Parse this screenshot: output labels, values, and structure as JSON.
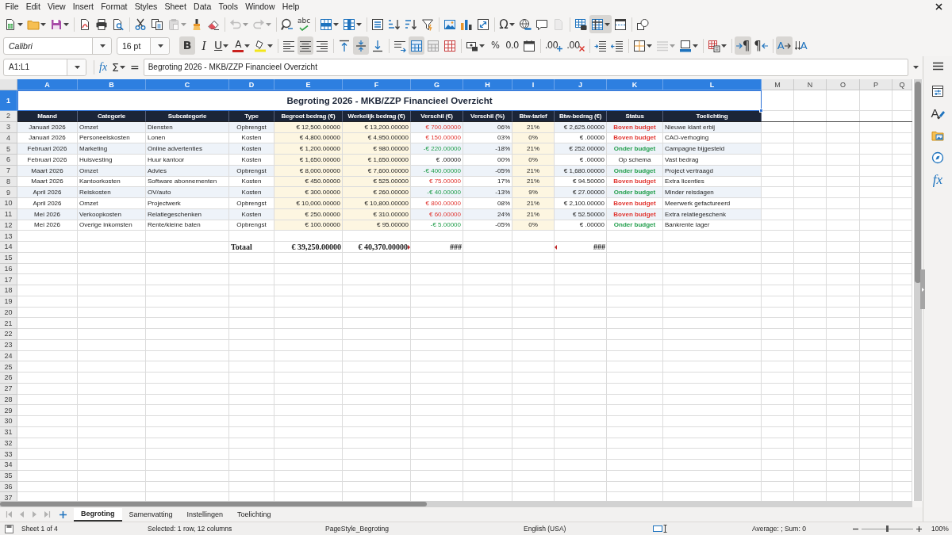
{
  "menu_bar": {
    "items": [
      "File",
      "Edit",
      "View",
      "Insert",
      "Format",
      "Styles",
      "Sheet",
      "Data",
      "Tools",
      "Window",
      "Help"
    ]
  },
  "standard_toolbar": [
    [
      {
        "pressed": false,
        "disabled": false,
        "dropdown": true
      },
      {
        "pressed": false,
        "disabled": false,
        "dropdown": true
      },
      {
        "pressed": false,
        "disabled": false,
        "dropdown": true
      }
    ],
    [
      {
        "pressed": false,
        "disabled": false,
        "dropdown": false
      },
      {
        "pressed": false,
        "disabled": false,
        "dropdown": false
      },
      {
        "pressed": false,
        "disabled": false,
        "dropdown": false
      }
    ],
    [
      {
        "pressed": false,
        "disabled": false,
        "dropdown": false
      },
      {
        "pressed": false,
        "disabled": false,
        "dropdown": false
      },
      {
        "pressed": false,
        "disabled": true,
        "dropdown": true
      },
      {
        "pressed": false,
        "disabled": false,
        "dropdown": false
      },
      {
        "pressed": false,
        "disabled": false,
        "dropdown": false
      }
    ],
    [
      {
        "pressed": false,
        "disabled": true,
        "dropdown": true
      },
      {
        "pressed": false,
        "disabled": true,
        "dropdown": true
      }
    ],
    [
      {
        "pressed": false,
        "disabled": false,
        "dropdown": false
      },
      {
        "pressed": false,
        "disabled": false,
        "dropdown": false,
        "glyph": "abc"
      }
    ],
    [
      {
        "pressed": false,
        "disabled": false,
        "dropdown": true
      },
      {
        "pressed": false,
        "disabled": false,
        "dropdown": true
      }
    ],
    [
      {
        "pressed": false,
        "disabled": false,
        "dropdown": false
      },
      {
        "pressed": false,
        "disabled": false,
        "dropdown": false
      },
      {
        "pressed": false,
        "disabled": false,
        "dropdown": false
      },
      {
        "pressed": false,
        "disabled": false,
        "dropdown": false
      }
    ],
    [
      {
        "pressed": false,
        "disabled": false,
        "dropdown": false
      },
      {
        "pressed": false,
        "disabled": false,
        "dropdown": false
      },
      {
        "pressed": false,
        "disabled": false,
        "dropdown": false
      }
    ],
    [
      {
        "pressed": false,
        "disabled": false,
        "dropdown": true,
        "glyph": "Ω"
      },
      {
        "pressed": false,
        "disabled": false,
        "dropdown": false
      },
      {
        "pressed": false,
        "disabled": false,
        "dropdown": false
      },
      {
        "pressed": false,
        "disabled": true,
        "dropdown": false
      }
    ],
    [
      {
        "pressed": false,
        "disabled": false,
        "dropdown": false
      },
      {
        "pressed": true,
        "disabled": false,
        "dropdown": true
      },
      {
        "pressed": false,
        "disabled": false,
        "dropdown": false
      }
    ],
    [
      {
        "pressed": false,
        "disabled": false,
        "dropdown": false
      }
    ]
  ],
  "formatting_toolbar": {
    "font_name": "Calibri",
    "font_size": "16 pt",
    "groups": [
      [
        {
          "pressed": true,
          "disabled": false,
          "dropdown": false,
          "glyph": "B"
        },
        {
          "pressed": false,
          "disabled": false,
          "dropdown": false,
          "glyph": "I"
        },
        {
          "pressed": false,
          "disabled": false,
          "dropdown": true,
          "glyph": "U"
        },
        {
          "pressed": false,
          "disabled": false,
          "dropdown": true,
          "glyph": "A"
        },
        {
          "pressed": false,
          "disabled": false,
          "dropdown": true
        }
      ],
      [
        {
          "pressed": false,
          "disabled": false,
          "dropdown": false
        },
        {
          "pressed": true,
          "disabled": false,
          "dropdown": false
        },
        {
          "pressed": false,
          "disabled": false,
          "dropdown": false
        }
      ],
      [
        {
          "pressed": false,
          "disabled": false,
          "dropdown": false
        },
        {
          "pressed": true,
          "disabled": false,
          "dropdown": false
        },
        {
          "pressed": false,
          "disabled": false,
          "dropdown": false
        }
      ],
      [
        {
          "pressed": false,
          "disabled": false,
          "dropdown": false
        },
        {
          "pressed": true,
          "disabled": false,
          "dropdown": false
        },
        {
          "pressed": false,
          "disabled": false,
          "dropdown": false
        },
        {
          "pressed": false,
          "disabled": false,
          "dropdown": false
        }
      ],
      [
        {
          "pressed": false,
          "disabled": false,
          "dropdown": true
        },
        {
          "pressed": false,
          "disabled": false,
          "dropdown": false,
          "glyph": "%"
        },
        {
          "pressed": false,
          "disabled": false,
          "dropdown": false,
          "glyph": "0.0"
        },
        {
          "pressed": false,
          "disabled": false,
          "dropdown": false
        }
      ],
      [
        {
          "pressed": false,
          "disabled": false,
          "dropdown": false,
          "glyph": ".00"
        },
        {
          "pressed": false,
          "disabled": false,
          "dropdown": false,
          "glyph": ".00"
        }
      ],
      [
        {
          "pressed": false,
          "disabled": false,
          "dropdown": false
        },
        {
          "pressed": false,
          "disabled": false,
          "dropdown": false
        }
      ],
      [
        {
          "pressed": false,
          "disabled": false,
          "dropdown": true
        },
        {
          "pressed": false,
          "disabled": true,
          "dropdown": true
        },
        {
          "pressed": false,
          "disabled": false,
          "dropdown": true
        }
      ],
      [
        {
          "pressed": false,
          "disabled": false,
          "dropdown": true
        }
      ],
      [
        {
          "pressed": true,
          "disabled": false,
          "dropdown": false,
          "glyph": "¶"
        },
        {
          "pressed": false,
          "disabled": false,
          "dropdown": false,
          "glyph": "¶"
        }
      ],
      [
        {
          "pressed": true,
          "disabled": false,
          "dropdown": false,
          "glyph": "A"
        },
        {
          "pressed": false,
          "disabled": false,
          "dropdown": false,
          "glyph": "A"
        }
      ]
    ]
  },
  "formula_bar": {
    "name_box": "A1:L1",
    "wizard_glyph": "fx",
    "sum_glyph": "Σ",
    "equals_glyph": "=",
    "content": "Begroting 2026 - MKB/ZZP Financieel Overzicht"
  },
  "sheet": {
    "columns": [
      {
        "label": "A",
        "selected": true
      },
      {
        "label": "B",
        "selected": true
      },
      {
        "label": "C",
        "selected": true
      },
      {
        "label": "D",
        "selected": true
      },
      {
        "label": "E",
        "selected": true
      },
      {
        "label": "F",
        "selected": true
      },
      {
        "label": "G",
        "selected": true
      },
      {
        "label": "H",
        "selected": true
      },
      {
        "label": "I",
        "selected": true
      },
      {
        "label": "J",
        "selected": true
      },
      {
        "label": "K",
        "selected": true
      },
      {
        "label": "L",
        "selected": true
      },
      {
        "label": "M",
        "selected": false
      },
      {
        "label": "N",
        "selected": false
      },
      {
        "label": "O",
        "selected": false
      },
      {
        "label": "P",
        "selected": false
      },
      {
        "label": "Q",
        "selected": false
      }
    ],
    "rows": [
      {
        "label": "1",
        "selected": true
      },
      {
        "label": "2",
        "selected": false
      },
      {
        "label": "3",
        "selected": false
      },
      {
        "label": "4",
        "selected": false
      },
      {
        "label": "5",
        "selected": false
      },
      {
        "label": "6",
        "selected": false
      },
      {
        "label": "7",
        "selected": false
      },
      {
        "label": "8",
        "selected": false
      },
      {
        "label": "9",
        "selected": false
      },
      {
        "label": "10",
        "selected": false
      },
      {
        "label": "11",
        "selected": false
      },
      {
        "label": "12",
        "selected": false
      },
      {
        "label": "13",
        "selected": false
      },
      {
        "label": "14",
        "selected": false
      },
      {
        "label": "15",
        "selected": false
      },
      {
        "label": "16",
        "selected": false
      },
      {
        "label": "17",
        "selected": false
      },
      {
        "label": "18",
        "selected": false
      },
      {
        "label": "19",
        "selected": false
      },
      {
        "label": "20",
        "selected": false
      },
      {
        "label": "21",
        "selected": false
      },
      {
        "label": "22",
        "selected": false
      },
      {
        "label": "23",
        "selected": false
      },
      {
        "label": "24",
        "selected": false
      },
      {
        "label": "25",
        "selected": false
      },
      {
        "label": "26",
        "selected": false
      },
      {
        "label": "27",
        "selected": false
      },
      {
        "label": "28",
        "selected": false
      },
      {
        "label": "29",
        "selected": false
      },
      {
        "label": "30",
        "selected": false
      },
      {
        "label": "31",
        "selected": false
      },
      {
        "label": "32",
        "selected": false
      },
      {
        "label": "33",
        "selected": false
      },
      {
        "label": "34",
        "selected": false
      },
      {
        "label": "35",
        "selected": false
      },
      {
        "label": "36",
        "selected": false
      },
      {
        "label": "37",
        "selected": false
      }
    ],
    "title": "Begroting 2026 - MKB/ZZP Financieel Overzicht",
    "header": [
      "Maand",
      "Categorie",
      "Subcategorie",
      "Type",
      "Begroot bedrag (€)",
      "Werkelijk bedrag (€)",
      "Verschil (€)",
      "Verschil (%)",
      "Btw-tarief",
      "Btw-bedrag (€)",
      "Status",
      "Toelichting"
    ],
    "data": [
      {
        "month": "Januari 2026",
        "category": "Omzet",
        "subcategory": "Diensten",
        "type": "Opbrengst",
        "budget": "€ 12,500.00000",
        "actual": "€ 13,200.00000",
        "difference": "€ 700.00000",
        "difference_pct": "06%",
        "vat_rate": "21%",
        "vat_amount": "€ 2,625.00000",
        "status": {
          "text": "Boven budget",
          "kind": "over"
        },
        "note": "Nieuwe klant erbij"
      },
      {
        "month": "Januari 2026",
        "category": "Personeelskosten",
        "subcategory": "Lonen",
        "type": "Kosten",
        "budget": "€ 4,800.00000",
        "actual": "€ 4,950.00000",
        "difference": "€ 150.00000",
        "difference_pct": "03%",
        "vat_rate": "0%",
        "vat_amount": "€ .00000",
        "status": {
          "text": "Boven budget",
          "kind": "over"
        },
        "note": "CAO-verhoging"
      },
      {
        "month": "Februari 2026",
        "category": "Marketing",
        "subcategory": "Online advertenties",
        "type": "Kosten",
        "budget": "€ 1,200.00000",
        "actual": "€ 980.00000",
        "difference": "-€ 220.00000",
        "difference_pct": "-18%",
        "vat_rate": "21%",
        "vat_amount": "€ 252.00000",
        "status": {
          "text": "Onder budget",
          "kind": "under"
        },
        "note": "Campagne bijgesteld"
      },
      {
        "month": "Februari 2026",
        "category": "Huisvesting",
        "subcategory": "Huur kantoor",
        "type": "Kosten",
        "budget": "€ 1,650.00000",
        "actual": "€ 1,650.00000",
        "difference": "€ .00000",
        "difference_pct": "00%",
        "vat_rate": "0%",
        "vat_amount": "€ .00000",
        "status": {
          "text": "Op schema",
          "kind": "on"
        },
        "note": "Vast bedrag"
      },
      {
        "month": "Maart 2026",
        "category": "Omzet",
        "subcategory": "Advies",
        "type": "Opbrengst",
        "budget": "€ 8,000.00000",
        "actual": "€ 7,600.00000",
        "difference": "-€ 400.00000",
        "difference_pct": "-05%",
        "vat_rate": "21%",
        "vat_amount": "€ 1,680.00000",
        "status": {
          "text": "Onder budget",
          "kind": "under"
        },
        "note": "Project vertraagd"
      },
      {
        "month": "Maart 2026",
        "category": "Kantoorkosten",
        "subcategory": "Software abonnementen",
        "type": "Kosten",
        "budget": "€ 450.00000",
        "actual": "€ 525.00000",
        "difference": "€ 75.00000",
        "difference_pct": "17%",
        "vat_rate": "21%",
        "vat_amount": "€ 94.50000",
        "status": {
          "text": "Boven budget",
          "kind": "over"
        },
        "note": "Extra licenties"
      },
      {
        "month": "April 2026",
        "category": "Reiskosten",
        "subcategory": "OV/auto",
        "type": "Kosten",
        "budget": "€ 300.00000",
        "actual": "€ 260.00000",
        "difference": "-€ 40.00000",
        "difference_pct": "-13%",
        "vat_rate": "9%",
        "vat_amount": "€ 27.00000",
        "status": {
          "text": "Onder budget",
          "kind": "under"
        },
        "note": "Minder reisdagen"
      },
      {
        "month": "April 2026",
        "category": "Omzet",
        "subcategory": "Projectwerk",
        "type": "Opbrengst",
        "budget": "€ 10,000.00000",
        "actual": "€ 10,800.00000",
        "difference": "€ 800.00000",
        "difference_pct": "08%",
        "vat_rate": "21%",
        "vat_amount": "€ 2,100.00000",
        "status": {
          "text": "Boven budget",
          "kind": "over"
        },
        "note": "Meerwerk gefactureerd"
      },
      {
        "month": "Mei 2026",
        "category": "Verkoopkosten",
        "subcategory": "Relatiegeschenken",
        "type": "Kosten",
        "budget": "€ 250.00000",
        "actual": "€ 310.00000",
        "difference": "€ 60.00000",
        "difference_pct": "24%",
        "vat_rate": "21%",
        "vat_amount": "€ 52.50000",
        "status": {
          "text": "Boven budget",
          "kind": "over"
        },
        "note": "Extra relatiegeschenk"
      },
      {
        "month": "Mei 2026",
        "category": "Overige inkomsten",
        "subcategory": "Rente/kleine baten",
        "type": "Opbrengst",
        "budget": "€ 100.00000",
        "actual": "€ 95.00000",
        "difference": "-€ 5.00000",
        "difference_pct": "-05%",
        "vat_rate": "0%",
        "vat_amount": "€ .00000",
        "status": {
          "text": "Onder budget",
          "kind": "under"
        },
        "note": "Bankrente lager"
      }
    ],
    "totals": {
      "label": {
        "text": "Totaal",
        "clipped_left": false,
        "clipped_right": false
      },
      "budget": {
        "text": "€ 39,250.00000",
        "clipped_left": false,
        "clipped_right": false
      },
      "actual": {
        "text": "€ 40,370.00000",
        "clipped_left": false,
        "clipped_right": true
      },
      "difference": {
        "text": "###",
        "clipped_left": false,
        "clipped_right": false
      },
      "vat_amount": {
        "text": "###",
        "clipped_left": true,
        "clipped_right": false
      }
    }
  },
  "sheet_navigation": [
    {
      "disabled": true
    },
    {
      "disabled": true
    },
    {
      "disabled": true
    },
    {
      "disabled": true
    }
  ],
  "sheet_tabs": [
    {
      "label": "Begroting",
      "selected": true
    },
    {
      "label": "Samenvatting",
      "selected": false
    },
    {
      "label": "Instellingen",
      "selected": false
    },
    {
      "label": "Toelichting",
      "selected": false
    }
  ],
  "sidebar": {
    "decks": [
      {
        "selected": false
      },
      {
        "selected": false,
        "glyph": "A"
      },
      {
        "selected": false
      },
      {
        "selected": false
      },
      {
        "selected": false,
        "glyph": "fx"
      }
    ]
  },
  "status_bar": {
    "sheet": "Sheet 1 of 4",
    "selection": "Selected: 1 row, 12 columns",
    "page_style": "PageStyle_Begroting",
    "language": "English (USA)",
    "summary": "Average: ; Sum: 0",
    "zoom": {
      "level": 0.5,
      "label": "100%"
    }
  }
}
